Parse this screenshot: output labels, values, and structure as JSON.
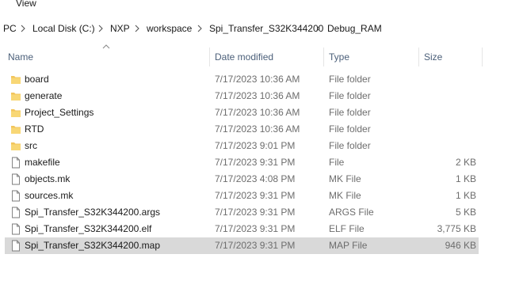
{
  "menu": {
    "view": "View"
  },
  "breadcrumb": [
    {
      "label": "PC"
    },
    {
      "label": "Local Disk (C:)"
    },
    {
      "label": "NXP"
    },
    {
      "label": "workspace"
    },
    {
      "label": "Spi_Transfer_S32K344200"
    },
    {
      "label": "Debug_RAM"
    }
  ],
  "columns": {
    "name": "Name",
    "date": "Date modified",
    "type": "Type",
    "size": "Size"
  },
  "icons": {
    "folder": "folder-icon",
    "file": "file-icon",
    "sort": "sort-up-icon",
    "separator": "chevron-right-icon"
  },
  "colors": {
    "folder": "#f2c55c",
    "selection": "#d9d9d9",
    "header_text": "#4c607a"
  },
  "files": [
    {
      "name": "board",
      "date": "7/17/2023 10:36 AM",
      "type": "File folder",
      "size": "",
      "kind": "folder"
    },
    {
      "name": "generate",
      "date": "7/17/2023 10:36 AM",
      "type": "File folder",
      "size": "",
      "kind": "folder"
    },
    {
      "name": "Project_Settings",
      "date": "7/17/2023 10:36 AM",
      "type": "File folder",
      "size": "",
      "kind": "folder"
    },
    {
      "name": "RTD",
      "date": "7/17/2023 10:36 AM",
      "type": "File folder",
      "size": "",
      "kind": "folder"
    },
    {
      "name": "src",
      "date": "7/17/2023 9:01 PM",
      "type": "File folder",
      "size": "",
      "kind": "folder"
    },
    {
      "name": "makefile",
      "date": "7/17/2023 9:31 PM",
      "type": "File",
      "size": "2 KB",
      "kind": "file"
    },
    {
      "name": "objects.mk",
      "date": "7/17/2023 4:08 PM",
      "type": "MK File",
      "size": "1 KB",
      "kind": "file"
    },
    {
      "name": "sources.mk",
      "date": "7/17/2023 9:31 PM",
      "type": "MK File",
      "size": "1 KB",
      "kind": "file"
    },
    {
      "name": "Spi_Transfer_S32K344200.args",
      "date": "7/17/2023 9:31 PM",
      "type": "ARGS File",
      "size": "5 KB",
      "kind": "file"
    },
    {
      "name": "Spi_Transfer_S32K344200.elf",
      "date": "7/17/2023 9:31 PM",
      "type": "ELF File",
      "size": "3,775 KB",
      "kind": "file"
    },
    {
      "name": "Spi_Transfer_S32K344200.map",
      "date": "7/17/2023 9:31 PM",
      "type": "MAP File",
      "size": "946 KB",
      "kind": "file",
      "selected": true
    }
  ]
}
